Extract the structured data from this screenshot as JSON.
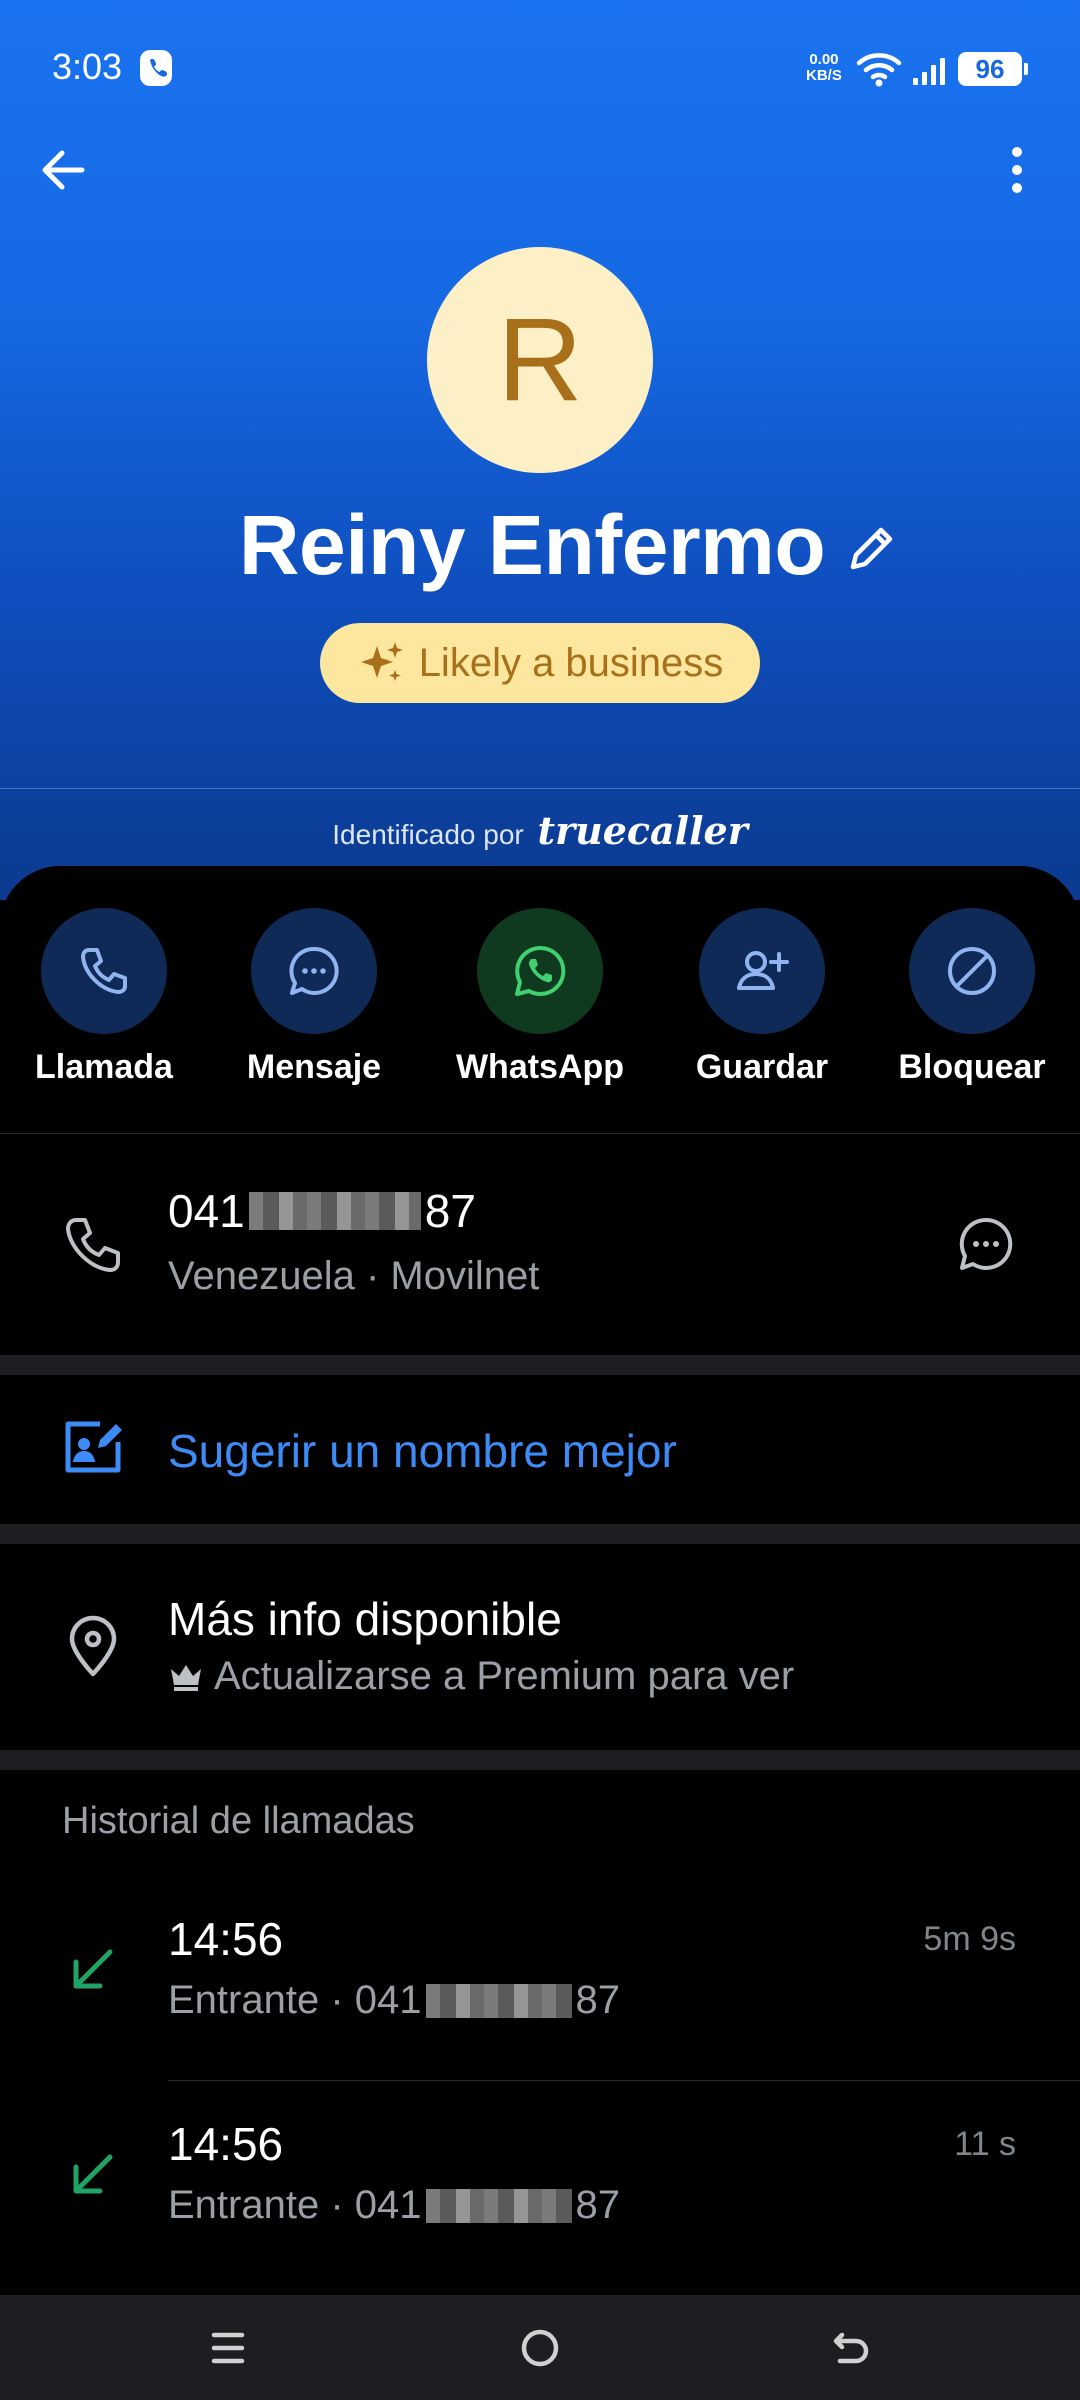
{
  "status_bar": {
    "time": "3:03",
    "net_speed_value": "0.00",
    "net_speed_unit": "KB/S",
    "battery": "96"
  },
  "contact": {
    "initial": "R",
    "name": "Reiny Enfermo",
    "badge": "Likely a business",
    "identified_by": "Identificado por",
    "brand": "truecaller"
  },
  "actions": [
    {
      "label": "Llamada",
      "icon": "phone-icon"
    },
    {
      "label": "Mensaje",
      "icon": "message-icon"
    },
    {
      "label": "WhatsApp",
      "icon": "whatsapp-icon"
    },
    {
      "label": "Guardar",
      "icon": "add-contact-icon"
    },
    {
      "label": "Bloquear",
      "icon": "block-icon"
    }
  ],
  "phone": {
    "prefix": "041",
    "suffix": "87",
    "carrier": "Venezuela · Movilnet"
  },
  "suggest": {
    "label": "Sugerir un nombre mejor"
  },
  "more_info": {
    "title": "Más info disponible",
    "subtitle": "Actualizarse a Premium para ver"
  },
  "history": {
    "title": "Historial de llamadas",
    "calls": [
      {
        "time": "14:56",
        "type": "Entrante",
        "prefix": "041",
        "suffix": "87",
        "duration": "5m 9s"
      },
      {
        "time": "14:56",
        "type": "Entrante",
        "prefix": "041",
        "suffix": "87",
        "duration": "11 s"
      }
    ]
  },
  "colors": {
    "accent_blue": "#1668e3",
    "avatar_bg": "#fdf0c6",
    "badge_bg": "#fde79e",
    "badge_text": "#a8701a",
    "incoming_green": "#1fa463",
    "link_blue": "#3d8bf5"
  }
}
